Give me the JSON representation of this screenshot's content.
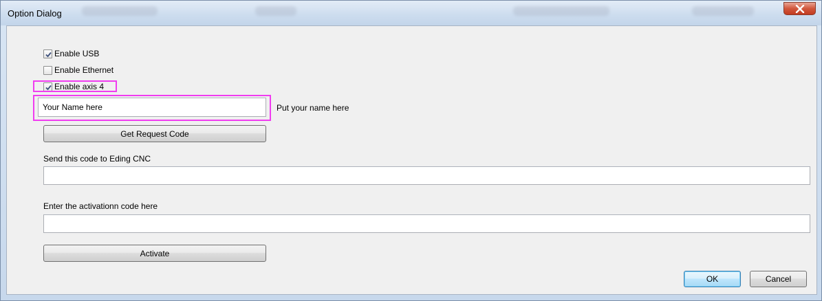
{
  "window": {
    "title": "Option Dialog"
  },
  "options": {
    "enable_usb": {
      "label": "Enable USB",
      "checked": true
    },
    "enable_ethernet": {
      "label": "Enable Ethernet",
      "checked": false
    },
    "enable_axis4": {
      "label": "Enable axis 4",
      "checked": true
    }
  },
  "name": {
    "value": "Your Name here",
    "hint": "Put your name here"
  },
  "buttons": {
    "get_request_code": "Get Request Code",
    "activate": "Activate",
    "ok": "OK",
    "cancel": "Cancel"
  },
  "request": {
    "label": "Send this code to Eding CNC",
    "value": ""
  },
  "activation": {
    "label": "Enter the activationn code here",
    "value": ""
  },
  "colors": {
    "highlight": "#f03cf0",
    "close_button": "#c9442a",
    "default_button_border": "#3c7fb1"
  }
}
